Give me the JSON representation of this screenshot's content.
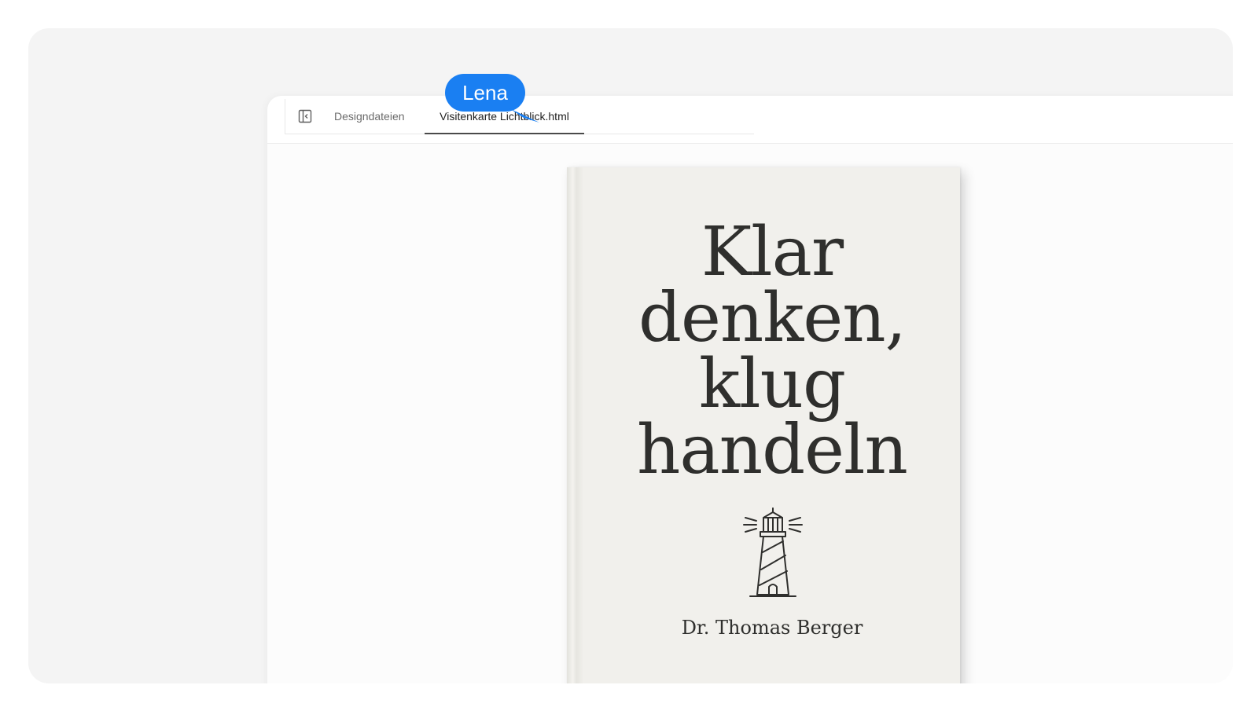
{
  "tabs": [
    {
      "label": "Designdateien",
      "active": false
    },
    {
      "label": "Visitenkarte Lichtblick.html",
      "active": true
    }
  ],
  "cursor": {
    "user": "Lena",
    "color": "#1a7ff2"
  },
  "book": {
    "title_lines": [
      "Klar",
      "denken,",
      "klug",
      "handeln"
    ],
    "author": "Dr. Thomas Berger",
    "emblem": "lighthouse-icon",
    "cover_color": "#f1f0ec",
    "text_color": "#2f2f2d"
  },
  "icons": {
    "sidebar_toggle": "sidebar-toggle-icon"
  }
}
